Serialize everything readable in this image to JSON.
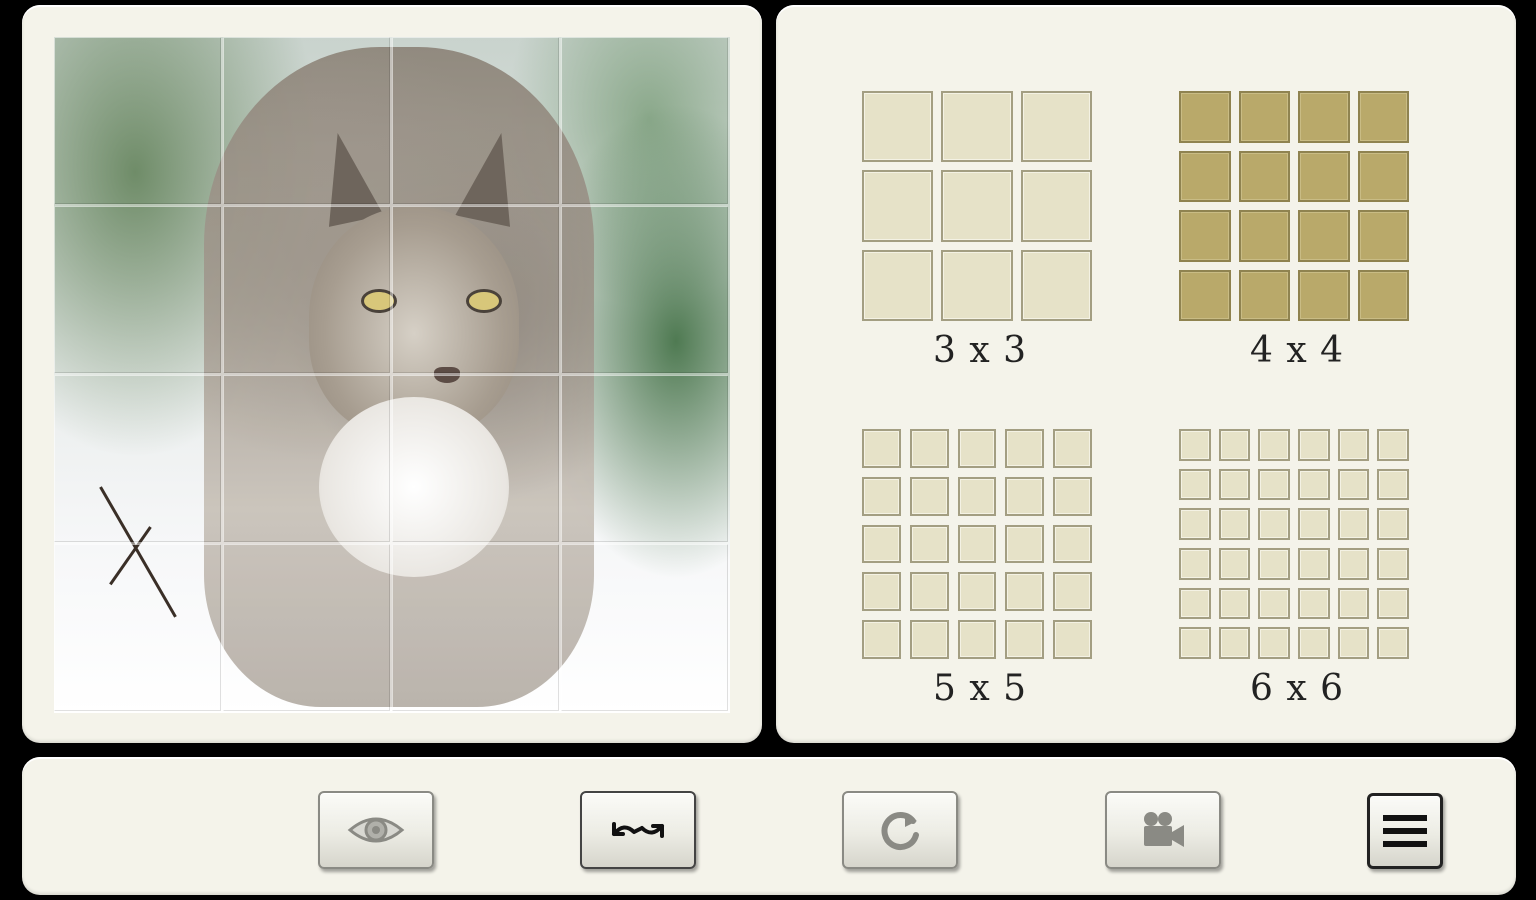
{
  "puzzle": {
    "image_subject": "lynx-in-snow",
    "grid_rows": 4,
    "grid_cols": 4
  },
  "size_options": [
    {
      "label": "3 x 3",
      "n": 3,
      "selected": false
    },
    {
      "label": "4 x 4",
      "n": 4,
      "selected": true
    },
    {
      "label": "5 x 5",
      "n": 5,
      "selected": false
    },
    {
      "label": "6 x 6",
      "n": 6,
      "selected": false
    }
  ],
  "toolbar": {
    "buttons": [
      {
        "icon": "eye-icon"
      },
      {
        "icon": "swap-arrows-icon"
      },
      {
        "icon": "rotate-icon"
      },
      {
        "icon": "video-camera-icon"
      },
      {
        "icon": "menu-icon"
      }
    ]
  },
  "colors": {
    "panel_bg": "#f4f3ea",
    "selected_cell": "#b9a96a",
    "unselected_cell": "#e6e2c8"
  }
}
